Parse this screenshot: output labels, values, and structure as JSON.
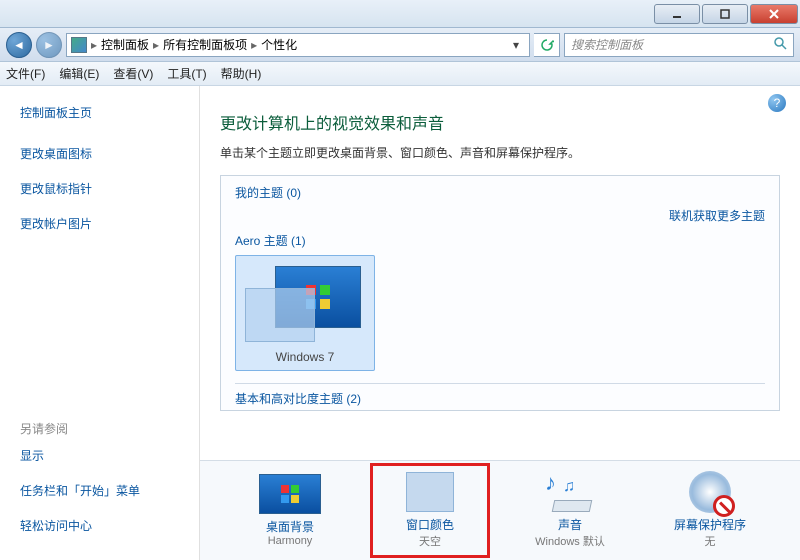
{
  "breadcrumb": {
    "root": "控制面板",
    "mid": "所有控制面板项",
    "leaf": "个性化"
  },
  "search": {
    "placeholder": "搜索控制面板"
  },
  "menu": {
    "file": "文件(F)",
    "edit": "编辑(E)",
    "view": "查看(V)",
    "tools": "工具(T)",
    "help": "帮助(H)"
  },
  "sidebar": {
    "home": "控制面板主页",
    "links": [
      "更改桌面图标",
      "更改鼠标指针",
      "更改帐户图片"
    ],
    "seealso_h": "另请参阅",
    "seealso": [
      "显示",
      "任务栏和「开始」菜单",
      "轻松访问中心"
    ]
  },
  "main": {
    "title": "更改计算机上的视觉效果和声音",
    "subtitle": "单击某个主题立即更改桌面背景、窗口颜色、声音和屏幕保护程序。",
    "my_themes": "我的主题 (0)",
    "more_online": "联机获取更多主题",
    "aero_themes": "Aero 主题 (1)",
    "aero_item": "Windows 7",
    "basic_themes": "基本和高对比度主题 (2)"
  },
  "bottom": {
    "desktop": {
      "cap": "桌面背景",
      "sub": "Harmony"
    },
    "color": {
      "cap": "窗口颜色",
      "sub": "天空"
    },
    "sound": {
      "cap": "声音",
      "sub": "Windows 默认"
    },
    "saver": {
      "cap": "屏幕保护程序",
      "sub": "无"
    }
  }
}
